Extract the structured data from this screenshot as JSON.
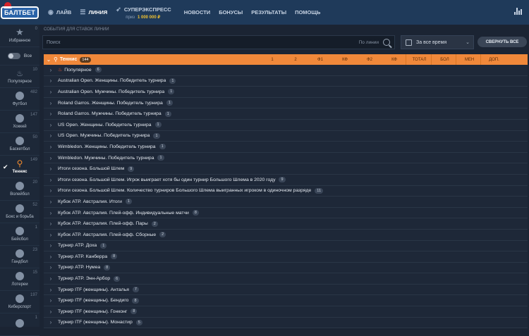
{
  "brand": {
    "logo_text": "БАЛТБЕТ"
  },
  "nav": {
    "live": "ЛАЙВ",
    "lines": "ЛИНИЯ",
    "superexpress": "СУПЕРЭКСПРЕСС",
    "prize_label": "приз",
    "prize_value": "1 000 000 ₽",
    "news": "НОВОСТИ",
    "bonuses": "БОНУСЫ",
    "results": "РЕЗУЛЬТАТЫ",
    "help": "ПОМОЩЬ"
  },
  "sidebar": {
    "all_label": "Все",
    "items": [
      {
        "label": "Избранное",
        "count": "0",
        "icon": "star-icon"
      },
      {
        "label": "Популярное",
        "count": "10",
        "icon": "fire-icon"
      },
      {
        "label": "Футбол",
        "count": "482",
        "icon": "football-icon"
      },
      {
        "label": "Хоккей",
        "count": "147",
        "icon": "hockey-icon"
      },
      {
        "label": "Баскетбол",
        "count": "50",
        "icon": "basketball-icon"
      },
      {
        "label": "Теннис",
        "count": "149",
        "icon": "tennis-icon",
        "active": true
      },
      {
        "label": "Волейбол",
        "count": "20",
        "icon": "volleyball-icon"
      },
      {
        "label": "Бокс и борьба",
        "count": "52",
        "icon": "boxing-icon"
      },
      {
        "label": "Бейсбол",
        "count": "1",
        "icon": "baseball-icon"
      },
      {
        "label": "Гандбол",
        "count": "23",
        "icon": "handball-icon"
      },
      {
        "label": "Лотереи",
        "count": "15",
        "icon": "lottery-icon"
      },
      {
        "label": "Киберспорт",
        "count": "197",
        "icon": "esports-icon"
      },
      {
        "label": "",
        "count": "1",
        "icon": "sport-icon"
      }
    ]
  },
  "main": {
    "section_title": "СОБЫТИЯ ДЛЯ СТАВОК ЛИНИИ",
    "search_placeholder": "Поиск",
    "search_by": "По линии",
    "period": "За все время",
    "collapse_all": "СВЕРНУТЬ ВСЕ"
  },
  "sport_header": {
    "title": "Теннис",
    "count": "144",
    "columns": [
      "1",
      "2",
      "Ф1",
      "КФ",
      "Ф2",
      "КФ",
      "ТОТАЛ",
      "БОЛ",
      "МЕН",
      "ДОП."
    ]
  },
  "rows": [
    {
      "name": "Популярное",
      "count": "6",
      "fire": true
    },
    {
      "name": "Australian Open. Женщины. Победитель турнира",
      "count": "1"
    },
    {
      "name": "Australian Open. Мужчины. Победитель турнира",
      "count": "1"
    },
    {
      "name": "Roland Garros. Женщины. Победитель турнира",
      "count": "1"
    },
    {
      "name": "Roland Garros. Мужчины. Победитель турнира",
      "count": "1"
    },
    {
      "name": "US Open. Женщины. Победитель турнира",
      "count": "1"
    },
    {
      "name": "US Open. Мужчины. Победитель турнира",
      "count": "1"
    },
    {
      "name": "Wimbledon. Женщины. Победитель турнира",
      "count": "1"
    },
    {
      "name": "Wimbledon. Мужчины. Победитель турнира",
      "count": "1"
    },
    {
      "name": "Итоги сезона. Большой Шлем",
      "count": "9"
    },
    {
      "name": "Итоги сезона. Большой Шлем. Игрок выиграет хотя бы один турнир Большого Шлема в 2020 году",
      "count": "9"
    },
    {
      "name": "Итоги сезона. Большой Шлем. Количество турниров Большого Шлема выигранных игроком в одиночном разряде",
      "count": "11"
    },
    {
      "name": "Кубок ATP. Австралия. Итоги",
      "count": "1"
    },
    {
      "name": "Кубок ATP. Австралия. Плей-офф. Индивидуальные матчи",
      "count": "8"
    },
    {
      "name": "Кубок ATP. Австралия. Плей-офф. Пары",
      "count": "2"
    },
    {
      "name": "Кубок ATP. Австралия. Плей-офф. Сборные",
      "count": "2"
    },
    {
      "name": "Турнир ATP. Доха",
      "count": "1"
    },
    {
      "name": "Турнир ATP. Канберра",
      "count": "8"
    },
    {
      "name": "Турнир ATP. Нумеа",
      "count": "8"
    },
    {
      "name": "Турнир ATP. Энн-Арбор",
      "count": "6"
    },
    {
      "name": "Турнир ITF (женщины). Анталья",
      "count": "7"
    },
    {
      "name": "Турнир ITF (женщины). Бендиго",
      "count": "8"
    },
    {
      "name": "Турнир ITF (женщины). Гонконг",
      "count": "8"
    },
    {
      "name": "Турнир ITF (женщины). Монастир",
      "count": "5"
    }
  ]
}
